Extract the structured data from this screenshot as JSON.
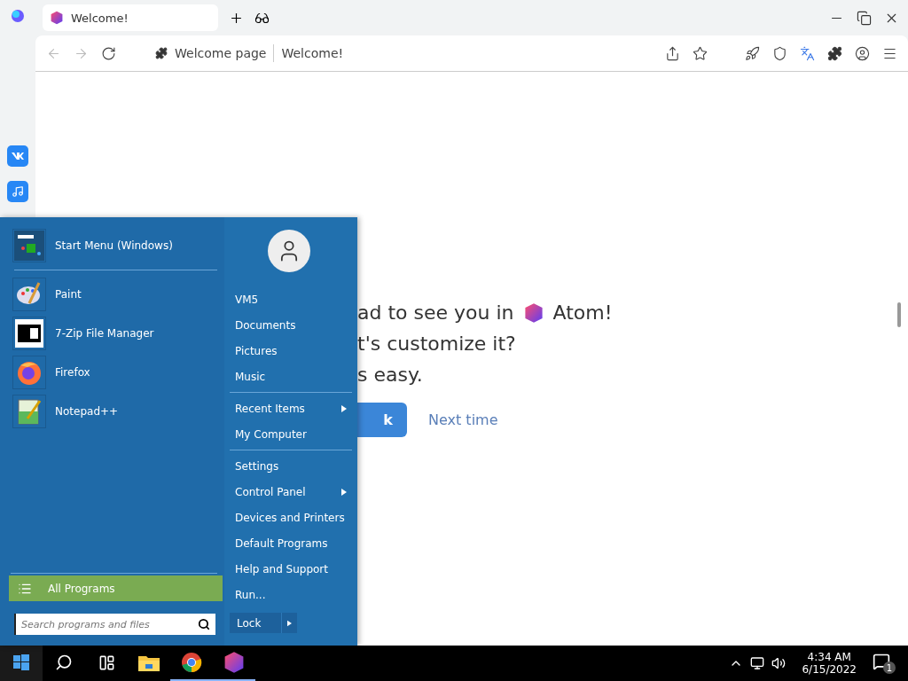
{
  "browser": {
    "tabs": [
      {
        "title": "Welcome!",
        "selected": true
      }
    ],
    "address": {
      "site_label": "Welcome page",
      "title": "Welcome!"
    }
  },
  "page": {
    "lines": [
      "ad to see you in",
      "t's customize it?",
      "s easy."
    ],
    "brand": "Atom!",
    "primary_button": "k",
    "secondary_link": "Next time"
  },
  "start_menu": {
    "pinned": [
      {
        "label": "Start Menu (Windows)",
        "kind": "start"
      },
      {
        "label": "Paint",
        "kind": "paint"
      },
      {
        "label": "7-Zip File Manager",
        "kind": "zip"
      },
      {
        "label": "Firefox",
        "kind": "firefox"
      },
      {
        "label": "Notepad++",
        "kind": "notepad"
      }
    ],
    "all_programs": "All Programs",
    "search": {
      "placeholder": "Search programs and files"
    },
    "groups": [
      {
        "items": [
          {
            "label": "VM5",
            "has_submenu": false
          },
          {
            "label": "Documents",
            "has_submenu": false
          },
          {
            "label": "Pictures",
            "has_submenu": false
          },
          {
            "label": "Music",
            "has_submenu": false
          }
        ]
      },
      {
        "items": [
          {
            "label": "Recent Items",
            "has_submenu": true
          },
          {
            "label": "My Computer",
            "has_submenu": false
          }
        ]
      },
      {
        "items": [
          {
            "label": "Settings",
            "has_submenu": false
          },
          {
            "label": "Control Panel",
            "has_submenu": true
          },
          {
            "label": "Devices and Printers",
            "has_submenu": false
          },
          {
            "label": "Default Programs",
            "has_submenu": false
          },
          {
            "label": "Help and Support",
            "has_submenu": false
          },
          {
            "label": "Run...",
            "has_submenu": false
          }
        ]
      }
    ],
    "lock": "Lock"
  },
  "taskbar": {
    "apps": [
      {
        "kind": "explorer",
        "running": false
      },
      {
        "kind": "chrome",
        "running": true
      },
      {
        "kind": "atom",
        "running": true
      }
    ],
    "clock": {
      "time": "4:34 AM",
      "date": "6/15/2022"
    },
    "notifications": "1"
  }
}
